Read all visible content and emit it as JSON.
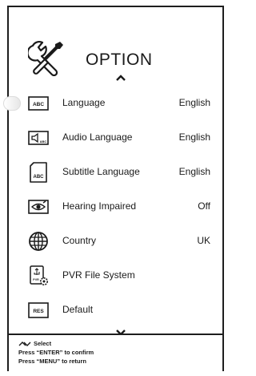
{
  "menu_title": "OPTION",
  "icons": {
    "header": "tools-icon",
    "scroll_up": "chevron-up-icon",
    "scroll_down": "chevron-down-icon",
    "footer_nav": "navigation-arrows-icon"
  },
  "items": [
    {
      "icon": "abc-icon",
      "icon_text": "ABC",
      "label": "Language",
      "value": "English",
      "selected": true
    },
    {
      "icon": "audio-language-icon",
      "icon_text": "ABC",
      "label": "Audio Language",
      "value": "English"
    },
    {
      "icon": "subtitle-icon",
      "icon_text": "ABC",
      "label": "Subtitle Language",
      "value": "English"
    },
    {
      "icon": "eye-icon",
      "label": "Hearing Impaired",
      "value": "Off"
    },
    {
      "icon": "globe-icon",
      "label": "Country",
      "value": "UK"
    },
    {
      "icon": "usb-drive-icon",
      "icon_text": "PVR",
      "label": "PVR File System",
      "value": ""
    },
    {
      "icon": "res-icon",
      "icon_text": "RES",
      "label": "Default",
      "value": ""
    }
  ],
  "footer": {
    "select_label": "Select",
    "confirm_hint": "Press “ENTER” to confirm",
    "return_hint": "Press “MENU” to return"
  },
  "colors": {
    "text": "#1a1a1a",
    "border": "#1e1e1e",
    "background": "#ffffff",
    "highlight": "#e6e6e6"
  }
}
